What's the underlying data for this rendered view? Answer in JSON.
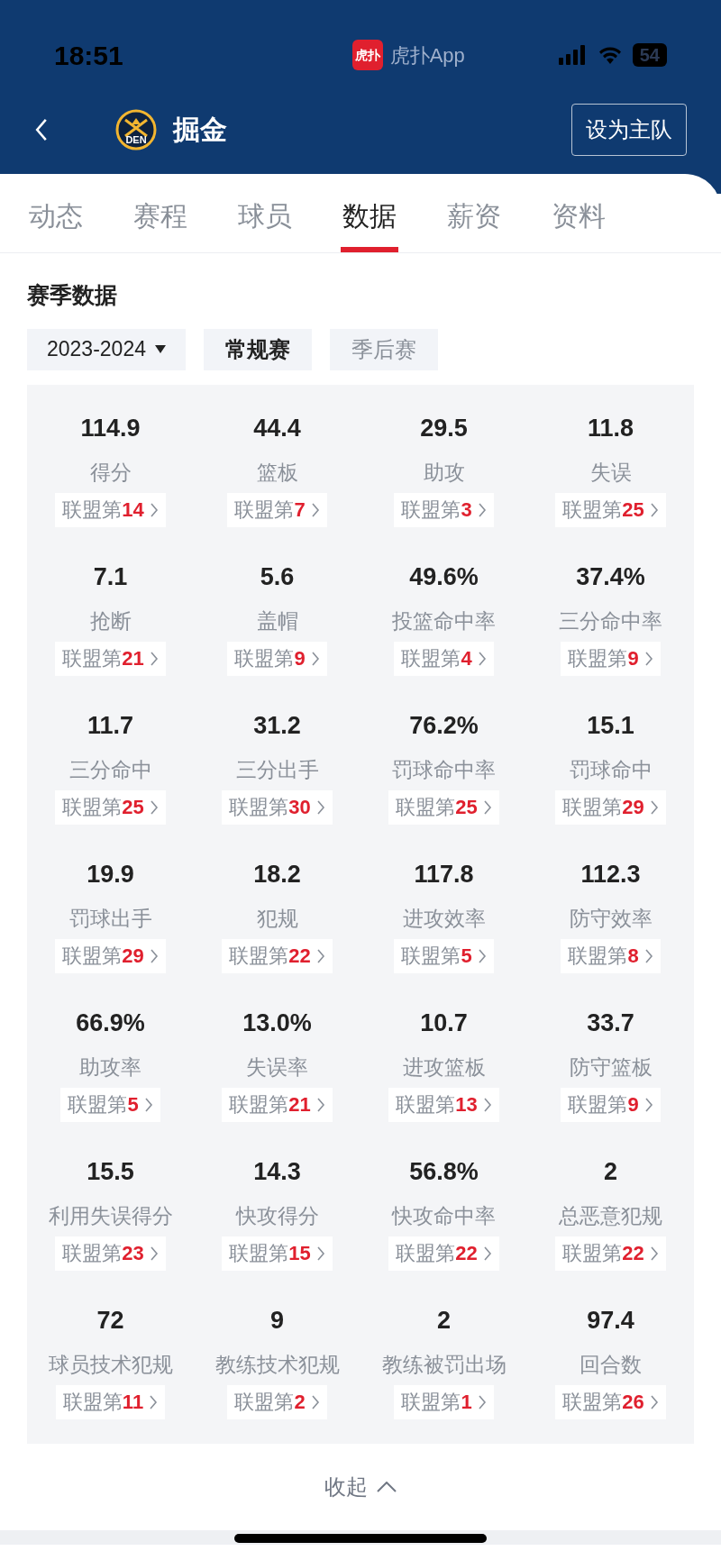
{
  "status_bar": {
    "time": "18:51",
    "app_label": "虎扑App",
    "app_icon_text": "虎扑",
    "battery": "54"
  },
  "header": {
    "team_name": "掘金",
    "logo_text": "DEN",
    "home_button": "设为主队"
  },
  "tabs": [
    {
      "label": "动态",
      "selected": false
    },
    {
      "label": "赛程",
      "selected": false
    },
    {
      "label": "球员",
      "selected": false
    },
    {
      "label": "数据",
      "selected": true
    },
    {
      "label": "薪资",
      "selected": false
    },
    {
      "label": "资料",
      "selected": false
    }
  ],
  "section_title": "赛季数据",
  "season_select": "2023-2024",
  "filters": [
    {
      "label": "常规赛",
      "selected": true
    },
    {
      "label": "季后赛",
      "selected": false
    }
  ],
  "stats": [
    {
      "value": "114.9",
      "label": "得分",
      "rank_label": "联盟第",
      "rank": "14"
    },
    {
      "value": "44.4",
      "label": "篮板",
      "rank_label": "联盟第",
      "rank": "7"
    },
    {
      "value": "29.5",
      "label": "助攻",
      "rank_label": "联盟第",
      "rank": "3"
    },
    {
      "value": "11.8",
      "label": "失误",
      "rank_label": "联盟第",
      "rank": "25"
    },
    {
      "value": "7.1",
      "label": "抢断",
      "rank_label": "联盟第",
      "rank": "21"
    },
    {
      "value": "5.6",
      "label": "盖帽",
      "rank_label": "联盟第",
      "rank": "9"
    },
    {
      "value": "49.6%",
      "label": "投篮命中率",
      "rank_label": "联盟第",
      "rank": "4"
    },
    {
      "value": "37.4%",
      "label": "三分命中率",
      "rank_label": "联盟第",
      "rank": "9"
    },
    {
      "value": "11.7",
      "label": "三分命中",
      "rank_label": "联盟第",
      "rank": "25"
    },
    {
      "value": "31.2",
      "label": "三分出手",
      "rank_label": "联盟第",
      "rank": "30"
    },
    {
      "value": "76.2%",
      "label": "罚球命中率",
      "rank_label": "联盟第",
      "rank": "25"
    },
    {
      "value": "15.1",
      "label": "罚球命中",
      "rank_label": "联盟第",
      "rank": "29"
    },
    {
      "value": "19.9",
      "label": "罚球出手",
      "rank_label": "联盟第",
      "rank": "29"
    },
    {
      "value": "18.2",
      "label": "犯规",
      "rank_label": "联盟第",
      "rank": "22"
    },
    {
      "value": "117.8",
      "label": "进攻效率",
      "rank_label": "联盟第",
      "rank": "5"
    },
    {
      "value": "112.3",
      "label": "防守效率",
      "rank_label": "联盟第",
      "rank": "8"
    },
    {
      "value": "66.9%",
      "label": "助攻率",
      "rank_label": "联盟第",
      "rank": "5"
    },
    {
      "value": "13.0%",
      "label": "失误率",
      "rank_label": "联盟第",
      "rank": "21"
    },
    {
      "value": "10.7",
      "label": "进攻篮板",
      "rank_label": "联盟第",
      "rank": "13"
    },
    {
      "value": "33.7",
      "label": "防守篮板",
      "rank_label": "联盟第",
      "rank": "9"
    },
    {
      "value": "15.5",
      "label": "利用失误得分",
      "rank_label": "联盟第",
      "rank": "23"
    },
    {
      "value": "14.3",
      "label": "快攻得分",
      "rank_label": "联盟第",
      "rank": "15"
    },
    {
      "value": "56.8%",
      "label": "快攻命中率",
      "rank_label": "联盟第",
      "rank": "22"
    },
    {
      "value": "2",
      "label": "总恶意犯规",
      "rank_label": "联盟第",
      "rank": "22"
    },
    {
      "value": "72",
      "label": "球员技术犯规",
      "rank_label": "联盟第",
      "rank": "11"
    },
    {
      "value": "9",
      "label": "教练技术犯规",
      "rank_label": "联盟第",
      "rank": "2"
    },
    {
      "value": "2",
      "label": "教练被罚出场",
      "rank_label": "联盟第",
      "rank": "1"
    },
    {
      "value": "97.4",
      "label": "回合数",
      "rank_label": "联盟第",
      "rank": "26"
    }
  ],
  "collapse_button": "收起"
}
